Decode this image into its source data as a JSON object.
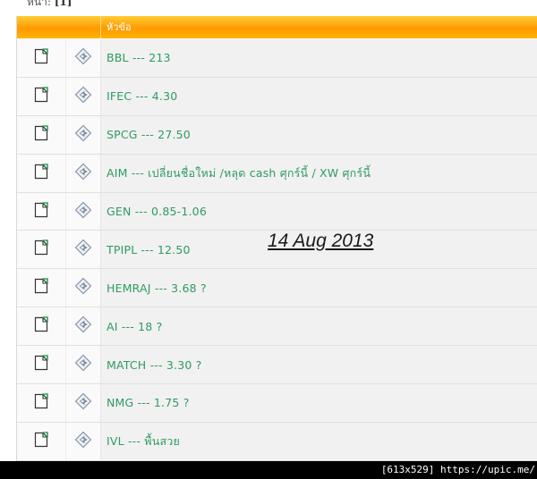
{
  "pagination": {
    "label": "หน้า:",
    "current": "[1]"
  },
  "table": {
    "header_title": "หัวข้อ",
    "rows": [
      {
        "title": "BBL --- 213"
      },
      {
        "title": "IFEC --- 4.30"
      },
      {
        "title": "SPCG --- 27.50"
      },
      {
        "title": "AIM --- เปลี่ยนชื่อใหม่ /หลุด cash ศุกร์นี้ / XW ศุกร์นี้"
      },
      {
        "title": "GEN --- 0.85-1.06"
      },
      {
        "title": "TPIPL --- 12.50"
      },
      {
        "title": "HEMRAJ --- 3.68 ?"
      },
      {
        "title": "AI --- 18 ?"
      },
      {
        "title": "MATCH --- 3.30 ?"
      },
      {
        "title": "NMG --- 1.75 ?"
      },
      {
        "title": "IVL --- พื้นสวย"
      }
    ]
  },
  "annotation": {
    "date": "14 Aug 2013"
  },
  "watermark": "[613x529] https://upic.me/",
  "icons": {
    "file": "file-icon",
    "status": "topic-status-icon"
  },
  "colors": {
    "header": "#ff9a00",
    "link": "#2e9b62"
  }
}
